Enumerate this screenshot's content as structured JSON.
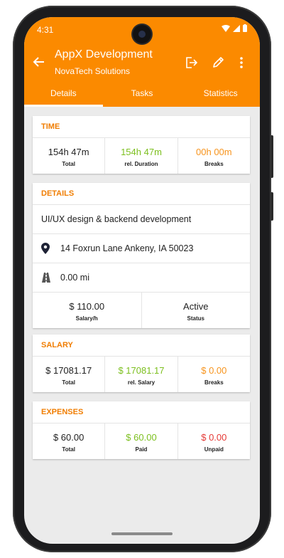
{
  "status_bar": {
    "time": "4:31"
  },
  "app_bar": {
    "title": "AppX Development",
    "subtitle": "NovaTech Solutions"
  },
  "tabs": [
    {
      "label": "Details"
    },
    {
      "label": "Tasks"
    },
    {
      "label": "Statistics"
    }
  ],
  "time_card": {
    "header": "TIME",
    "cells": [
      {
        "value": "154h 47m",
        "label": "Total"
      },
      {
        "value": "154h 47m",
        "label": "rel. Duration"
      },
      {
        "value": "00h 00m",
        "label": "Breaks"
      }
    ]
  },
  "details_card": {
    "header": "DETAILS",
    "description": "UI/UX design & backend development",
    "address": "14 Foxrun Lane Ankeny, IA 50023",
    "distance": "0.00 mi",
    "cells": [
      {
        "value": "$ 110.00",
        "label": "Salary/h"
      },
      {
        "value": "Active",
        "label": "Status"
      }
    ]
  },
  "salary_card": {
    "header": "SALARY",
    "cells": [
      {
        "value": "$ 17081.17",
        "label": "Total"
      },
      {
        "value": "$ 17081.17",
        "label": "rel. Salary"
      },
      {
        "value": "$ 0.00",
        "label": "Breaks"
      }
    ]
  },
  "expenses_card": {
    "header": "EXPENSES",
    "cells": [
      {
        "value": "$ 60.00",
        "label": "Total"
      },
      {
        "value": "$ 60.00",
        "label": "Paid"
      },
      {
        "value": "$ 0.00",
        "label": "Unpaid"
      }
    ]
  },
  "colors": {
    "accent": "#fb8a00",
    "header_text": "#f07d00",
    "green": "#7cbf1e",
    "orange": "#f7941d",
    "red": "#e53935"
  },
  "icons": [
    "back-arrow-icon",
    "export-icon",
    "edit-pencil-icon",
    "more-vert-icon",
    "location-pin-icon",
    "road-icon",
    "wifi-icon",
    "signal-icon",
    "battery-icon"
  ]
}
